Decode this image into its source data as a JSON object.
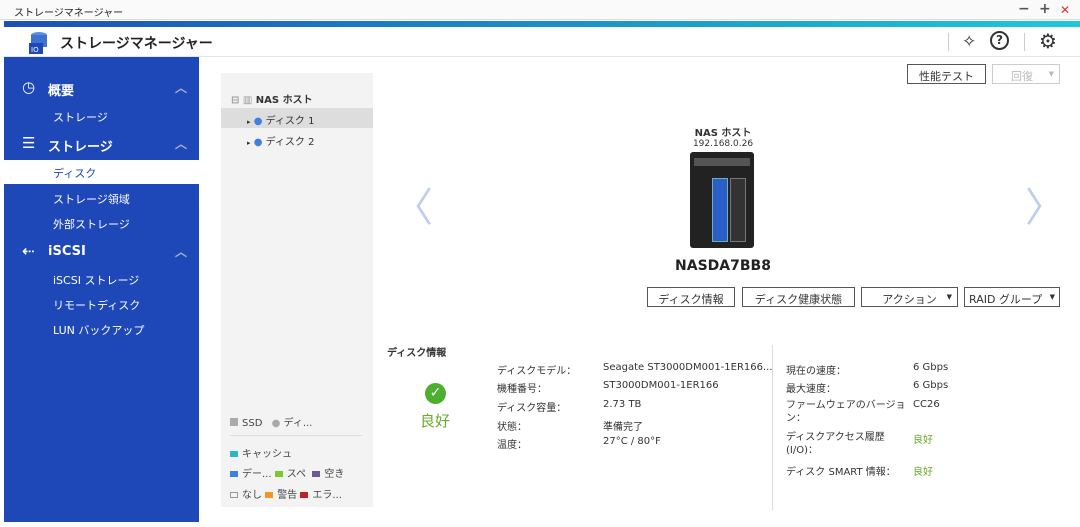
{
  "window": {
    "title": "ストレージマネージャー",
    "minimize": "−",
    "maximize": "+",
    "close": "✕"
  },
  "header": {
    "title": "ストレージマネージャー"
  },
  "sidebar": {
    "sections": [
      {
        "label": "概要",
        "items": [
          {
            "label": "ストレージ"
          }
        ]
      },
      {
        "label": "ストレージ",
        "items": [
          {
            "label": "ディスク"
          },
          {
            "label": "ストレージ領域"
          },
          {
            "label": "外部ストレージ"
          }
        ]
      },
      {
        "label": "iSCSI",
        "items": [
          {
            "label": "iSCSI ストレージ"
          },
          {
            "label": "リモートディスク"
          },
          {
            "label": "LUN バックアップ"
          }
        ]
      }
    ]
  },
  "tree": {
    "root": "NAS ホスト",
    "disks": [
      "ディスク 1",
      "ディスク 2"
    ]
  },
  "legend": {
    "ssd": "SSD",
    "disk": "ディ...",
    "cache": "キャッシュ",
    "data": "デー...",
    "spare": "スペ",
    "free": "空き",
    "none": "なし",
    "warning": "警告",
    "error": "エラ..."
  },
  "colors": {
    "sidebar": "#1e48b8",
    "cache": "#2fb6c6",
    "data": "#3f7fe0",
    "spare": "#7cc832",
    "free": "#6a5a9a",
    "warning": "#f0962a",
    "error": "#c02020",
    "good": "#6aaa2a"
  },
  "toolbar": {
    "perf_test": "性能テスト",
    "recover": "回復"
  },
  "device": {
    "host_label": "NAS ホスト",
    "ip": "192.168.0.26",
    "name": "NASDA7BB8"
  },
  "actions": {
    "disk_info": "ディスク情報",
    "disk_health": "ディスク健康状態",
    "action": "アクション",
    "raid_group": "RAID グループ"
  },
  "info": {
    "title": "ディスク情報",
    "status": "良好",
    "left": [
      {
        "k": "ディスクモデル：",
        "v": "Seagate ST3000DM001-1ER166..."
      },
      {
        "k": "機種番号：",
        "v": "ST3000DM001-1ER166"
      },
      {
        "k": "ディスク容量：",
        "v": "2.73 TB"
      },
      {
        "k": "状態：",
        "v": "準備完了"
      },
      {
        "k": "温度：",
        "v": "27°C / 80°F"
      }
    ],
    "right": [
      {
        "k": "現在の速度：",
        "v": "6 Gbps"
      },
      {
        "k": "最大速度：",
        "v": "6 Gbps"
      },
      {
        "k": "ファームウェアのバージョン：",
        "v": "CC26"
      },
      {
        "k": "ディスクアクセス履歴 (I/O)：",
        "v": "良好"
      },
      {
        "k": "ディスク SMART 情報：",
        "v": "良好"
      }
    ]
  }
}
